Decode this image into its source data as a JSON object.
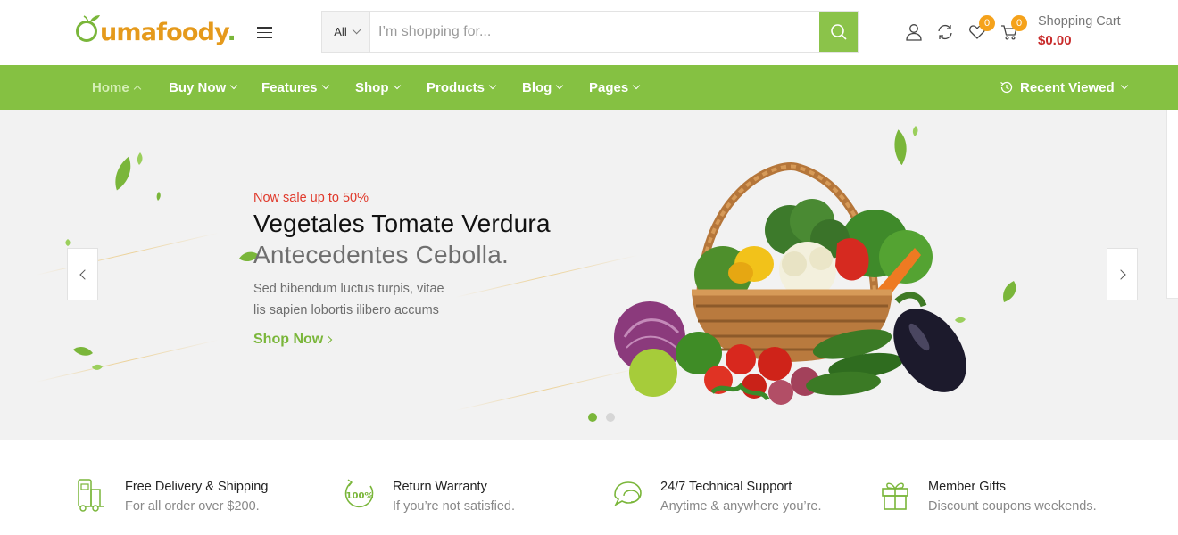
{
  "logo": {
    "o": "O",
    "rest": "umafoody",
    "dot": "."
  },
  "search": {
    "category": "All",
    "placeholder": "I’m shopping for..."
  },
  "header": {
    "wishlist_count": "0",
    "cart_count": "0",
    "cart_label": "Shopping Cart",
    "cart_total": "$0.00"
  },
  "nav": {
    "items": [
      {
        "label": "Home",
        "active": true
      },
      {
        "label": "Buy Now"
      },
      {
        "label": "Features"
      },
      {
        "label": "Shop"
      },
      {
        "label": "Products"
      },
      {
        "label": "Blog"
      },
      {
        "label": "Pages"
      }
    ],
    "recent": "Recent Viewed"
  },
  "hero": {
    "sale": "Now sale up to 50%",
    "title_line1": "Vegetales Tomate Verdura",
    "title_line2": "Antecedentes Cebolla.",
    "desc_line1": "Sed bibendum luctus turpis, vitae",
    "desc_line2": "lis sapien lobortis ilibero accums",
    "cta": "Shop Now",
    "slide_count": 2,
    "active_slide": 1
  },
  "features": [
    {
      "icon": "delivery-icon",
      "title": "Free Delivery & Shipping",
      "subtitle": "For all order over $200."
    },
    {
      "icon": "hundred-percent-icon",
      "title": "Return Warranty",
      "subtitle": "If you’re not satisfied."
    },
    {
      "icon": "chat-support-icon",
      "title": "24/7 Technical Support",
      "subtitle": "Anytime & anywhere you’re."
    },
    {
      "icon": "gift-icon",
      "title": "Member Gifts",
      "subtitle": "Discount coupons weekends."
    }
  ],
  "colors": {
    "brand_green": "#85c142",
    "logo_orange": "#e59a1c",
    "badge_orange": "#f5a21b",
    "sale_red": "#e0392b",
    "price_red": "#c82b2b"
  }
}
